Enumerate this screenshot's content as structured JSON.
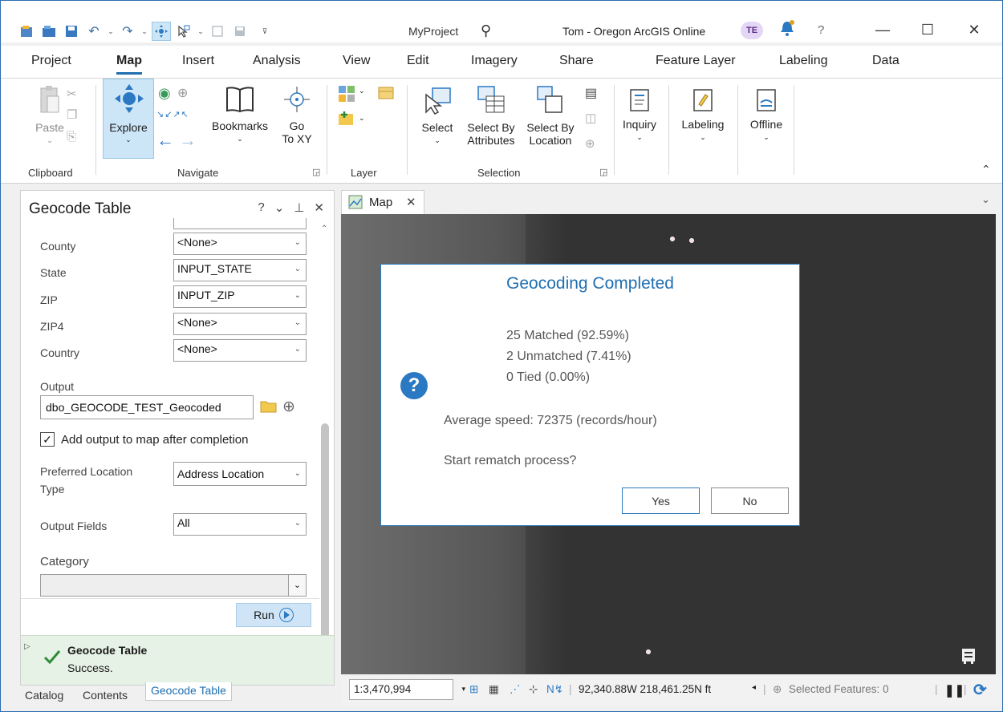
{
  "title_bar": {
    "project_name": "MyProject",
    "user_text": "Tom - Oregon ArcGIS Online",
    "avatar_initials": "TE",
    "help_glyph": "?",
    "minimize_glyph": "—",
    "maximize_glyph": "☐",
    "close_glyph": "✕"
  },
  "ribbon_tabs": [
    "Project",
    "Map",
    "Insert",
    "Analysis",
    "View",
    "Edit",
    "Imagery",
    "Share",
    "Feature Layer",
    "Labeling",
    "Data"
  ],
  "active_tab": "Map",
  "ribbon": {
    "clipboard": {
      "paste": "Paste",
      "group": "Clipboard"
    },
    "navigate": {
      "explore": "Explore",
      "bookmarks": "Bookmarks",
      "go": "Go",
      "to_xy": "To XY",
      "group": "Navigate"
    },
    "layer": {
      "group": "Layer"
    },
    "selection": {
      "select": "Select",
      "select_by": "Select By",
      "attributes": "Attributes",
      "select_by2": "Select By",
      "location": "Location",
      "group": "Selection"
    },
    "inquiry": "Inquiry",
    "labeling": "Labeling",
    "offline": "Offline"
  },
  "pane": {
    "title": "Geocode Table",
    "controls": {
      "help": "?",
      "menu": "⌄",
      "pin": "⊥",
      "close": "✕"
    },
    "fields": [
      {
        "label": "County",
        "value": "<None>"
      },
      {
        "label": "State",
        "value": "INPUT_STATE"
      },
      {
        "label": "ZIP",
        "value": "INPUT_ZIP"
      },
      {
        "label": "ZIP4",
        "value": "<None>"
      },
      {
        "label": "Country",
        "value": "<None>"
      }
    ],
    "output_label": "Output",
    "output_value": "dbo_GEOCODE_TEST_Geocoded",
    "add_output_label": "Add output to map after completion",
    "add_output_checked": true,
    "pref_loc_label_1": "Preferred Location",
    "pref_loc_label_2": "Type",
    "pref_loc_value": "Address Location",
    "output_fields_label": "Output Fields",
    "output_fields_value": "All",
    "category_label": "Category",
    "category_value": "",
    "run_label": "Run",
    "status_title": "Geocode Table",
    "status_text": "Success."
  },
  "bottom_tabs": [
    "Catalog",
    "Contents",
    "Geocode Table"
  ],
  "active_bottom_tab": "Geocode Table",
  "map_tab": {
    "label": "Map"
  },
  "dialog": {
    "title": "Geocoding Completed",
    "matched": "25 Matched (92.59%)",
    "unmatched": "2 Unmatched (7.41%)",
    "tied": "0 Tied (0.00%)",
    "speed": "Average speed: 72375 (records/hour)",
    "prompt": "Start rematch process?",
    "yes": "Yes",
    "no": "No"
  },
  "status_bar": {
    "scale": "1:3,470,994",
    "coordinates": "92,340.88W 218,461.25N ft",
    "selected_features": "Selected Features: 0"
  },
  "colors": {
    "accent": "#1f6fb2",
    "map_bg": "#333333",
    "success_bg": "#e6f2e6"
  }
}
